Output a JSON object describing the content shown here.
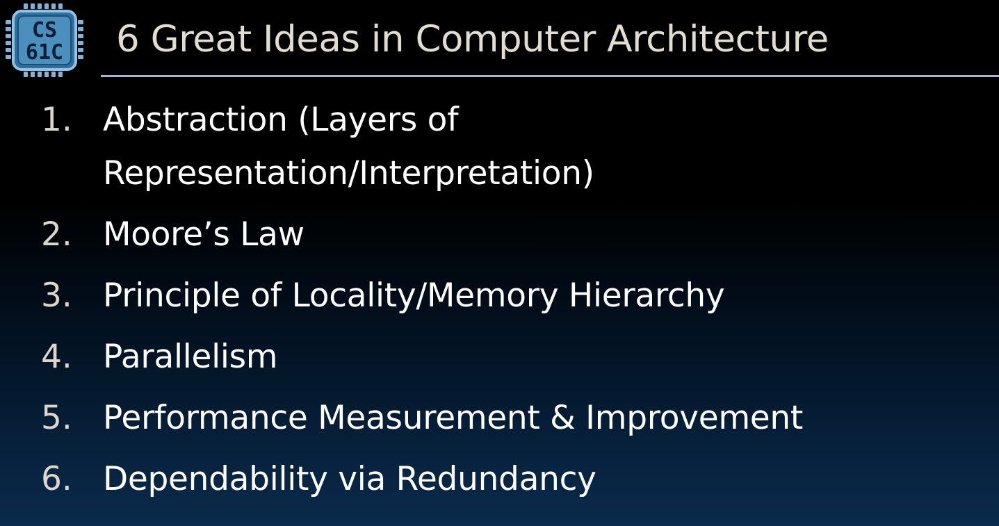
{
  "slide": {
    "title": "6 Great Ideas in Computer Architecture",
    "logo": {
      "line1": "CS",
      "line2": "61C",
      "icon": "cpu-chip-logo-icon",
      "colors": {
        "chip_fill": "#2f6f9e",
        "chip_border": "#8fc3e6",
        "pins": "#7fb3d8",
        "text": "#0b1d33"
      }
    },
    "items": [
      {
        "number": "1.",
        "lines": [
          "Abstraction (Layers of",
          "Representation/Interpretation)"
        ]
      },
      {
        "number": "2.",
        "lines": [
          "Moore’s Law"
        ]
      },
      {
        "number": "3.",
        "lines": [
          "Principle of Locality/Memory Hierarchy"
        ]
      },
      {
        "number": "4.",
        "lines": [
          "Parallelism"
        ]
      },
      {
        "number": "5.",
        "lines": [
          "Performance Measurement & Improvement"
        ]
      },
      {
        "number": "6.",
        "lines": [
          "Dependability via Redundancy"
        ]
      }
    ],
    "colors": {
      "background_top": "#000000",
      "background_bottom": "#0a2b4c",
      "title": "#e3ddd0",
      "rule": "#9db9d8",
      "number": "#ddd7c9",
      "text": "#ffffff"
    }
  }
}
